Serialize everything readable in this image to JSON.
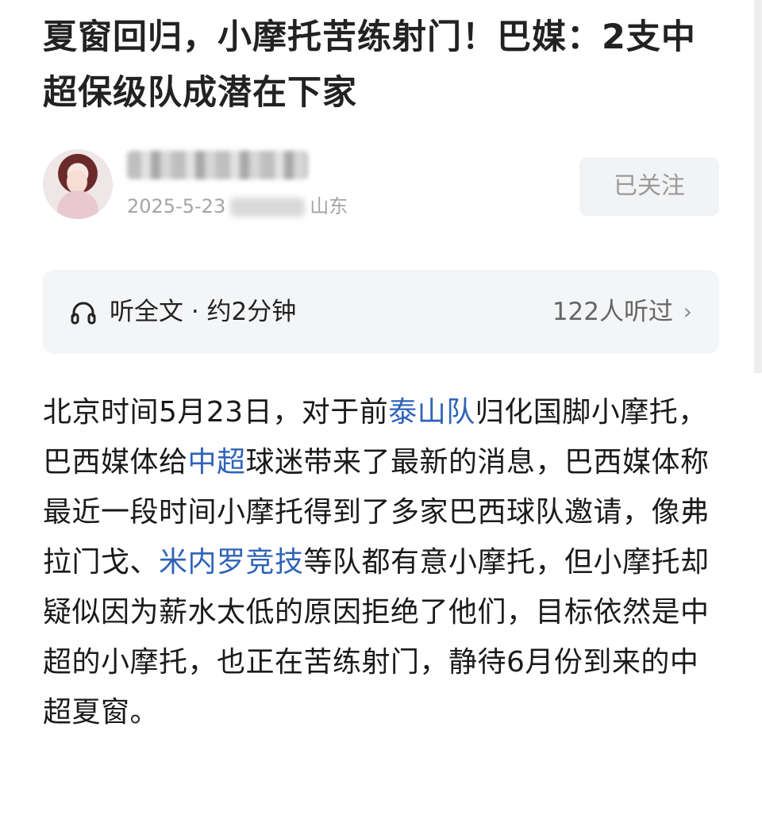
{
  "article": {
    "title": "夏窗回归，小摩托苦练射门！巴媒：2支中超保级队成潜在下家"
  },
  "author": {
    "name": "",
    "date": "2025-5-23",
    "location": "山东",
    "follow_label": "已关注"
  },
  "listen": {
    "label": "听全文 · 约2分钟",
    "count": "122人听过",
    "chevron": "›",
    "icon": "headphones-icon"
  },
  "content": {
    "seg1": "北京时间5月23日，对于前",
    "link1": "泰山队",
    "seg2": "归化国脚小摩托，巴西媒体给",
    "link2": "中超",
    "seg3": "球迷带来了最新的消息，巴西媒体称最近一段时间小摩托得到了多家巴西球队邀请，像弗拉门戈、",
    "link3": "米内罗竞技",
    "seg4": "等队都有意小摩托，但小摩托却疑似因为薪水太低的原因拒绝了他们，目标依然是中超的小摩托，也正在苦练射门，静待6月份到来的中超夏窗。"
  },
  "colors": {
    "link": "#2f63b8",
    "follow_bg": "#f2f3f5",
    "listen_bg": "#f4f5f7"
  }
}
